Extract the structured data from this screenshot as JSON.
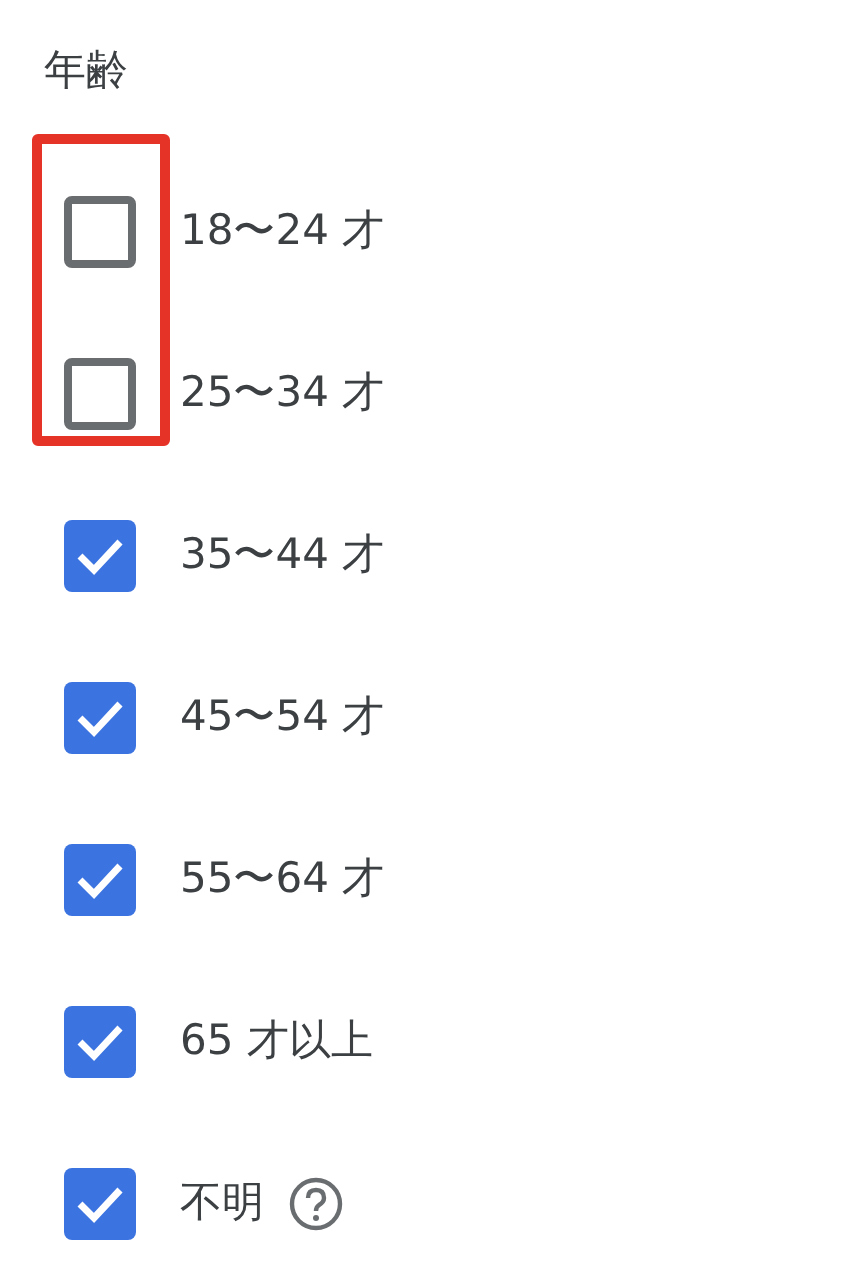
{
  "title": "年齢",
  "options": [
    {
      "label": "18〜24 才",
      "checked": false,
      "highlighted": true,
      "help": false
    },
    {
      "label": "25〜34 才",
      "checked": false,
      "highlighted": true,
      "help": false
    },
    {
      "label": "35〜44 才",
      "checked": true,
      "highlighted": false,
      "help": false
    },
    {
      "label": "45〜54 才",
      "checked": true,
      "highlighted": false,
      "help": false
    },
    {
      "label": "55〜64 才",
      "checked": true,
      "highlighted": false,
      "help": false
    },
    {
      "label": "65 才以上",
      "checked": true,
      "highlighted": false,
      "help": false
    },
    {
      "label": "不明",
      "checked": true,
      "highlighted": false,
      "help": true
    }
  ]
}
